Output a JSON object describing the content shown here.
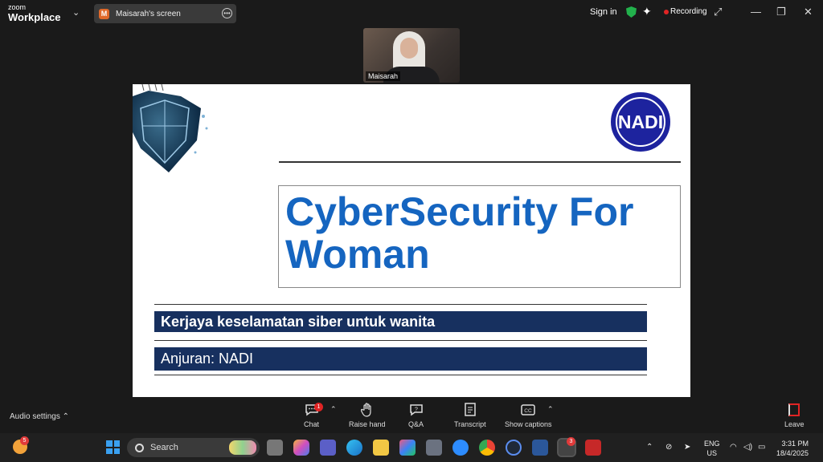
{
  "titlebar": {
    "brand_top": "zoom",
    "brand_bottom": "Workplace",
    "screen_tab_initial": "M",
    "screen_tab_label": "Maisarah's screen",
    "sign_in": "Sign in",
    "recording": "Recording"
  },
  "participant": {
    "name": "Maisarah"
  },
  "slide": {
    "logo_text": "NADI",
    "title_line1": "CyberSecurity For",
    "title_line2": "Woman",
    "subtitle": "Kerjaya keselamatan siber untuk wanita",
    "organizer": "Anjuran: NADI",
    "colors": {
      "title": "#1565c0",
      "bar": "#17305f",
      "logo": "#1d239e"
    }
  },
  "controls": {
    "audio_settings": "Audio settings",
    "chat": "Chat",
    "chat_badge": "1",
    "raise_hand": "Raise hand",
    "qa": "Q&A",
    "transcript": "Transcript",
    "show_captions": "Show captions",
    "leave": "Leave"
  },
  "taskbar": {
    "weather_badge": "5",
    "search_placeholder": "Search",
    "discord_badge": "3",
    "lang_line1": "ENG",
    "lang_line2": "US",
    "time": "3:31 PM",
    "date": "18/4/2025"
  },
  "icons": {
    "share_more": "ellipsis-icon",
    "shield": "security-shield-icon",
    "sparkle": "ai-companion-icon"
  }
}
